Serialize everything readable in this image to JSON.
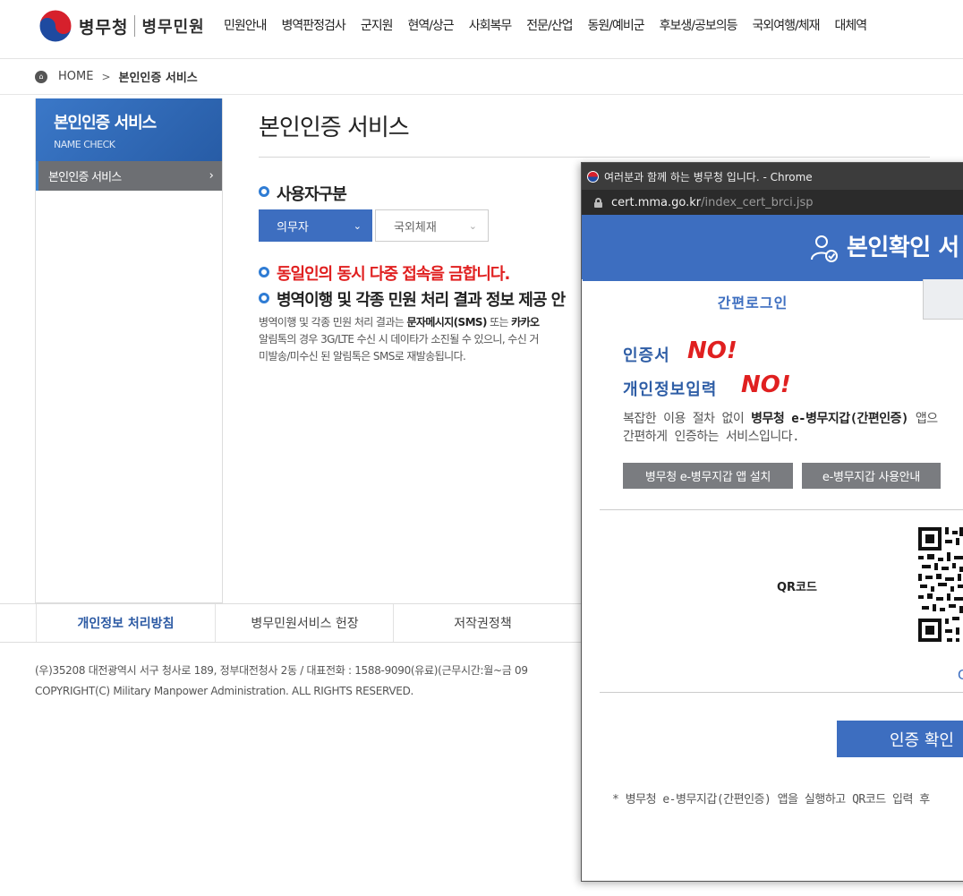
{
  "header": {
    "logo_main": "병무청",
    "logo_sub": "병무민원",
    "nav": [
      "민원안내",
      "병역판정검사",
      "군지원",
      "현역/상근",
      "사회복무",
      "전문/산업",
      "동원/예비군",
      "후보생/공보의등",
      "국외여행/체재",
      "대체역"
    ]
  },
  "breadcrumb": {
    "home": "HOME",
    "arrow": ">",
    "current": "본인인증 서비스"
  },
  "sidebar": {
    "title": "본인인증 서비스",
    "subtitle": "NAME CHECK",
    "item_label": "본인인증 서비스",
    "item_arrow": "›"
  },
  "main": {
    "title": "본인인증 서비스",
    "user_heading": "사용자구분",
    "select_a": "의무자",
    "select_b": "국외체재",
    "chev": "⌄",
    "warning": "동일인의 동시 다중 접속을 금합니다.",
    "info_heading": "병역이행 및 각종 민원 처리 결과 정보 제공 안",
    "info_line1_pre": "병역이행 및 각종 민원 처리 결과는 ",
    "info_line1_bold1": "문자메시지(SMS)",
    "info_line1_mid": " 또는 ",
    "info_line1_bold2": "카카오",
    "info_line2": "알림톡의 경우 3G/LTE 수신 시 데이타가 소진될 수 있으니, 수신 거",
    "info_line3": "미발송/미수신 된 알림톡은 SMS로 재발송됩니다."
  },
  "footer": {
    "links": [
      "개인정보 처리방침",
      "병무민원서비스 헌장",
      "저작권정책"
    ],
    "address": "(우)35208 대전광역시 서구 청사로 189, 정부대전청사 2동 / 대표전화 : 1588-9090(유료)(근무시간:월~금 09",
    "copyright": "COPYRIGHT(C) Military Manpower Administration. ALL RIGHTS RESERVED."
  },
  "popup": {
    "window_title": "여러분과 함께 하는 병무청 입니다. - Chrome",
    "url_host": "cert.mma.go.kr",
    "url_path": "/index_cert_brci.jsp",
    "banner_title": "본인확인 서",
    "tab_active": "간편로그인",
    "cert_label": "인증서",
    "no_text": "NO!",
    "info_label": "개인정보입력",
    "desc_line1_pre": "복잡한 이용 절차 없이 ",
    "desc_line1_bold": "병무청 e-병무지갑(간편인증)",
    "desc_line1_post": " 앱으",
    "desc_line2": "간편하게 인증하는 서비스입니다.",
    "btn_install": "병무청 e-병무지갑 앱 설치",
    "btn_guide": "e-병무지갑 사용안내",
    "qr_label": "QR코드",
    "qr_link": "C",
    "confirm_btn": "인증 확인",
    "footnote": "* 병무청 e-병무지갑(간편인증) 앱을 실행하고 QR코드 입력 후"
  }
}
